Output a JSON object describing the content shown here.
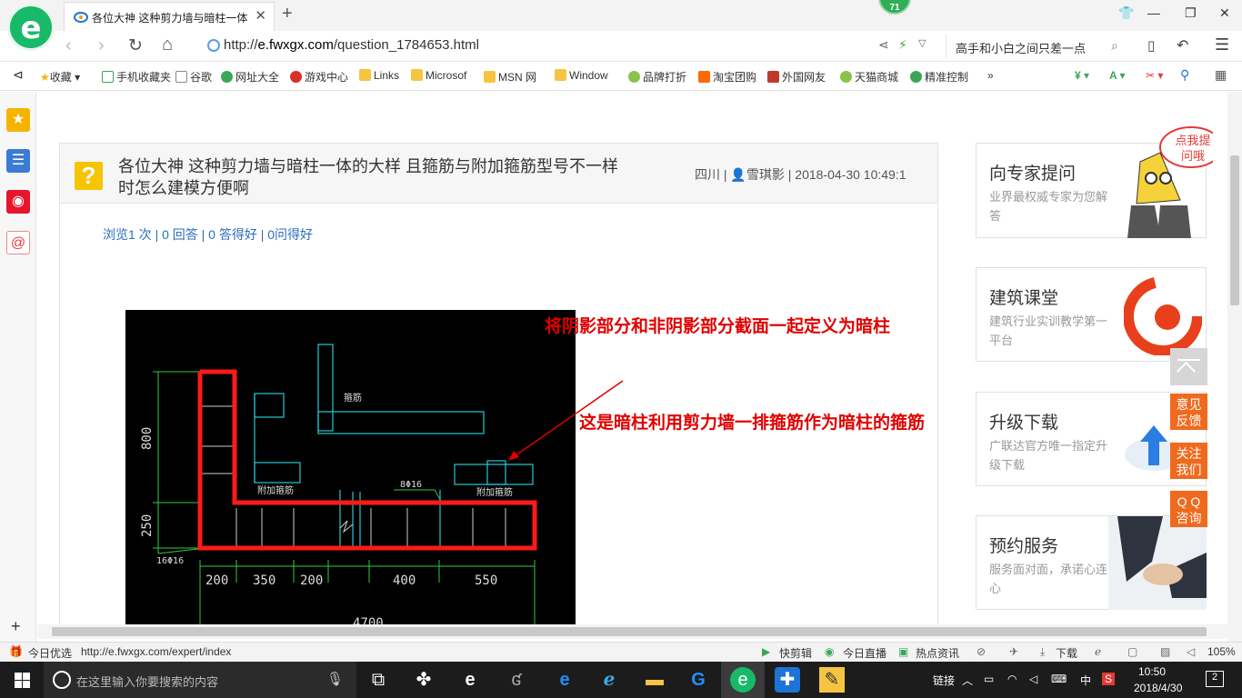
{
  "browser": {
    "tab_title": "各位大神 这种剪力墙与暗柱一体",
    "badge_count": "71",
    "url_prefix": "http://",
    "url_host": "e.fwxgx.com",
    "url_path": "/question_1784653.html",
    "search_text": "高手和小白之间只差一点"
  },
  "bookmarks": [
    "收藏",
    "手机收藏夹",
    "谷歌",
    "网址大全",
    "游戏中心",
    "Links",
    "Microsof",
    "MSN 网",
    "Window",
    "品牌打折",
    "淘宝团购",
    "外国网友",
    "天猫商城",
    "精准控制"
  ],
  "question": {
    "title_line1": "各位大神 这种剪力墙与暗柱一体的大样 且箍筋与附加箍筋型号不一样",
    "title_line2": "时怎么建模方便啊",
    "region": "四川",
    "author": "雪琪影",
    "datetime": "2018-04-30 10:49:1",
    "stats": "浏览1 次 | 0 回答 | 0 答得好 | 0问得好"
  },
  "cad": {
    "dim_800": "800",
    "dim_250": "250",
    "rebar_left": "16Φ16",
    "rebar_mid": "8Φ16",
    "label_gujin": "箍筋",
    "label_fujia_left": "附加箍筋",
    "label_fujia_right": "附加箍筋",
    "dims": [
      "200",
      "350",
      "200",
      "400",
      "550"
    ],
    "total": "4700"
  },
  "annotations": {
    "a1": "将阴影部分和非阴影部分截面一起定义为暗柱",
    "a2": "这是暗柱利用剪力墙一排箍筋作为暗柱的箍筋"
  },
  "side": {
    "ask_title": "向专家提问",
    "ask_sub": "业界最权威专家为您解答",
    "ask_bubble": "点我提问哦",
    "course_title": "建筑课堂",
    "course_sub": "建筑行业实训教学第一平台",
    "upgrade_title": "升级下载",
    "upgrade_sub": "广联达官方唯一指定升级下载",
    "booking_title": "预约服务",
    "booking_sub": "服务面对面，承诺心连心"
  },
  "float_buttons": {
    "feedback": "意见反馈",
    "follow": "关注我们",
    "qq": "Q Q咨询"
  },
  "statusbar": {
    "left_label": "今日优选",
    "link": "http://e.fwxgx.com/expert/index",
    "kuaijianji": "快剪辑",
    "live": "今日直播",
    "news": "热点资讯",
    "download": "下载",
    "zoom": "105%"
  },
  "taskbar": {
    "search_placeholder": "在这里输入你要搜索的内容",
    "links": "链接",
    "ime": "中",
    "time": "10:50",
    "date": "2018/4/30",
    "notif": "2"
  },
  "colors": {
    "accent_green": "#19b96a",
    "link_blue": "#2a6ebb",
    "annotation_red": "#e00000",
    "float_orange": "#f06a1e"
  }
}
